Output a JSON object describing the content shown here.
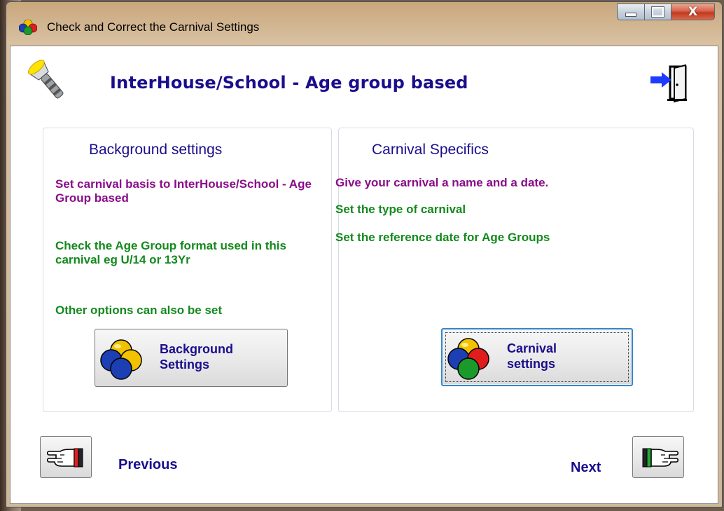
{
  "window": {
    "title": "Check and Correct the Carnival Settings",
    "close_glyph": "X"
  },
  "header": {
    "heading": "InterHouse/School - Age group based",
    "torch_icon": "torch-icon",
    "exit_icon": "exit-door-icon"
  },
  "left_panel": {
    "title": "Background settings",
    "line1": "Set carnival basis to InterHouse/School - Age Group based",
    "line2": "Check the Age Group format used in this carnival eg U/14 or 13Yr",
    "line3": "Other options can also be set",
    "button_label": "Background\nSettings"
  },
  "right_panel": {
    "title": "Carnival Specifics",
    "line1": "Give your carnival a name and a date.",
    "line2": "Set the type of carnival",
    "line3": "Set the reference date for Age Groups",
    "button_label": "Carnival\nsettings"
  },
  "footer": {
    "previous_label": "Previous",
    "next_label": "Next"
  },
  "colors": {
    "heading": "#1a0e8c",
    "purple_text": "#8a0d8a",
    "green_text": "#13891d"
  }
}
